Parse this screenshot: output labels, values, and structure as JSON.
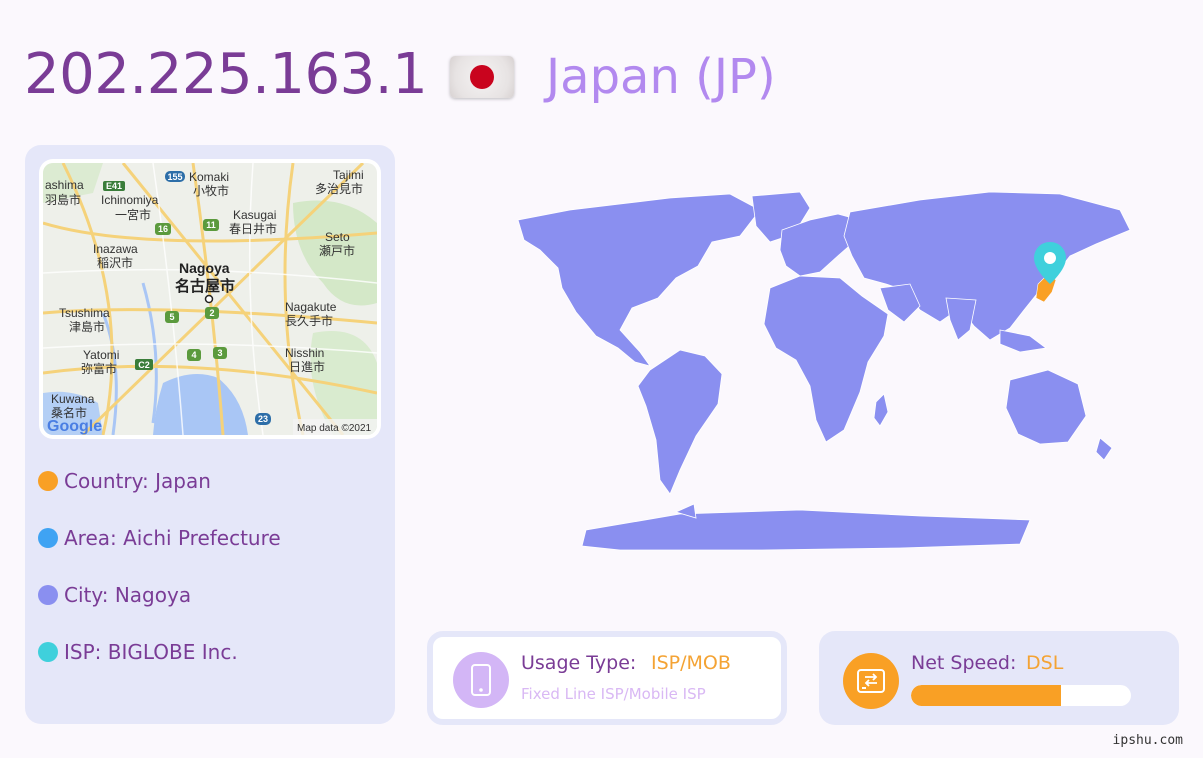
{
  "header": {
    "ip": "202.225.163.1",
    "country": "Japan (JP)"
  },
  "map": {
    "labels": {
      "c1": "ashima",
      "c1_jp": "羽島市",
      "ichinomiya": "Ichinomiya",
      "ichinomiya_jp": "一宮市",
      "komaki": "Komaki",
      "komaki_jp": "小牧市",
      "tajimi": "Tajimi",
      "tajimi_jp": "多治見市",
      "kasugai": "Kasugai",
      "kasugai_jp": "春日井市",
      "inazawa": "Inazawa",
      "inazawa_jp": "稲沢市",
      "seto": "Seto",
      "seto_jp": "瀬戸市",
      "nagoya": "Nagoya",
      "nagoya_jp": "名古屋市",
      "tsushima": "Tsushima",
      "tsushima_jp": "津島市",
      "nagakute": "Nagakute",
      "nagakute_jp": "長久手市",
      "yatomi": "Yatomi",
      "yatomi_jp": "弥富市",
      "nisshin": "Nisshin",
      "nisshin_jp": "日進市",
      "kuwana": "Kuwana",
      "kuwana_jp": "桑名市",
      "google": "Google",
      "attribution": "Map data ©2021",
      "r_e41": "E41",
      "r_155": "155",
      "r_16": "16",
      "r_11": "11",
      "r_5": "5",
      "r_2": "2",
      "r_4": "4",
      "r_3": "3",
      "r_c2": "C2",
      "r_23": "23"
    }
  },
  "details": {
    "country": "Country: Japan",
    "area": "Area: Aichi Prefecture",
    "city": "City: Nagoya",
    "isp": "ISP: BIGLOBE Inc."
  },
  "usage": {
    "label": "Usage Type:",
    "value": "ISP/MOB",
    "sub": "Fixed Line ISP/Mobile ISP"
  },
  "speed": {
    "label": "Net Speed:",
    "value": "DSL",
    "level": 0.68
  },
  "footer": "ipshu.com",
  "colors": {
    "purple": "#7a3c96",
    "lilac": "#b289ef",
    "orange": "#f9a025",
    "blue": "#3fa3f3",
    "periwinkle": "#8a8ff0",
    "cyan": "#3fd0dc"
  }
}
